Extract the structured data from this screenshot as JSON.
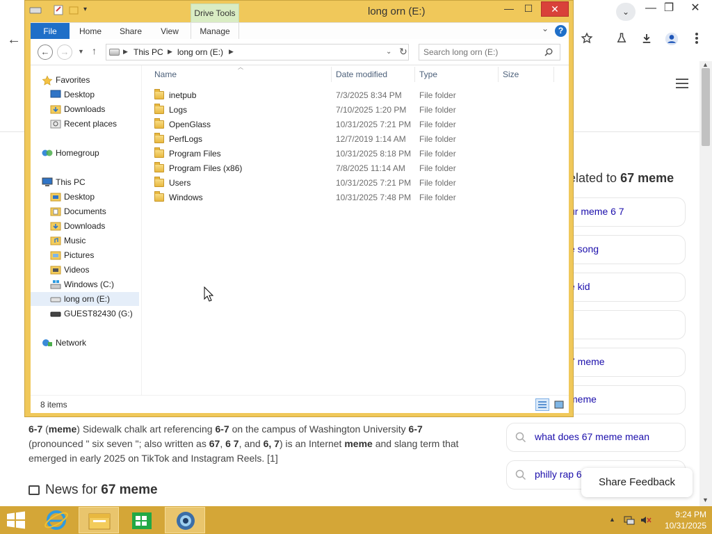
{
  "browser": {
    "tab_search_symbol": "⌄",
    "window_controls": {
      "minimize": "—",
      "maximize": "❐",
      "close": "✕"
    },
    "toolbar_icons": [
      "star-icon",
      "flask-icon",
      "download-icon",
      "profile-icon",
      "more-icon"
    ],
    "back_symbol": "←"
  },
  "page": {
    "related": {
      "title_prefix": "elated to ",
      "title_bold": "67 meme",
      "items": [
        {
          "text": "ur meme 6 7",
          "icon": "search-icon"
        },
        {
          "text": "e song",
          "icon": "search-icon"
        },
        {
          "text": "e kid",
          "icon": "search-icon"
        },
        {
          "text": "",
          "icon": "search-icon"
        },
        {
          "text": "7 meme",
          "icon": "search-icon"
        },
        {
          "text": "meme",
          "icon": "search-icon"
        },
        {
          "text": "what does 67 meme mean",
          "icon": "search-icon"
        },
        {
          "text": "philly rap 6",
          "icon": "search-icon"
        }
      ]
    },
    "snippet": {
      "t1": "6-7",
      "t2": " (",
      "t3": "meme",
      "t4": ") Sidewalk chalk art referencing ",
      "t5": "6-7",
      "t6": " on the campus of Washington University ",
      "t7": "6-7",
      "t8": " (pronounced \" six seven \"; also written as ",
      "t9": "67",
      "t10": ", ",
      "t11": "6 7",
      "t12": ", and ",
      "t13": "6, 7",
      "t14": ") is an Internet ",
      "t15": "meme",
      "t16": " and slang term that emerged in early 2025 on TikTok and Instagram Reels. [1]"
    },
    "news": {
      "prefix": "News for ",
      "bold": "67 meme"
    },
    "share_feedback": "Share Feedback"
  },
  "explorer": {
    "title": "long orn (E:)",
    "context_tab": "Drive Tools",
    "window_controls": {
      "minimize": "—",
      "maximize": "☐",
      "close": "✕"
    },
    "ribbon_tabs": {
      "file": "File",
      "home": "Home",
      "share": "Share",
      "view": "View",
      "manage": "Manage"
    },
    "help": "?",
    "address": {
      "root": "This PC",
      "current": "long orn (E:)"
    },
    "search_placeholder": "Search long orn (E:)",
    "nav_pane": {
      "favorites": "Favorites",
      "desktop_fav": "Desktop",
      "downloads_fav": "Downloads",
      "recent": "Recent places",
      "homegroup": "Homegroup",
      "this_pc": "This PC",
      "desktop": "Desktop",
      "documents": "Documents",
      "downloads": "Downloads",
      "music": "Music",
      "pictures": "Pictures",
      "videos": "Videos",
      "drive_c": "Windows (C:)",
      "drive_e": "long orn (E:)",
      "drive_g": "GUEST82430 (G:)",
      "network": "Network"
    },
    "columns": {
      "name": "Name",
      "date": "Date modified",
      "type": "Type",
      "size": "Size"
    },
    "files": [
      {
        "name": "inetpub",
        "date": "7/3/2025 8:34 PM",
        "type": "File folder",
        "size": ""
      },
      {
        "name": "Logs",
        "date": "7/10/2025 1:20 PM",
        "type": "File folder",
        "size": ""
      },
      {
        "name": "OpenGlass",
        "date": "10/31/2025 7:21 PM",
        "type": "File folder",
        "size": ""
      },
      {
        "name": "PerfLogs",
        "date": "12/7/2019 1:14 AM",
        "type": "File folder",
        "size": ""
      },
      {
        "name": "Program Files",
        "date": "10/31/2025 8:18 PM",
        "type": "File folder",
        "size": ""
      },
      {
        "name": "Program Files (x86)",
        "date": "7/8/2025 11:14 AM",
        "type": "File folder",
        "size": ""
      },
      {
        "name": "Users",
        "date": "10/31/2025 7:21 PM",
        "type": "File folder",
        "size": ""
      },
      {
        "name": "Windows",
        "date": "10/31/2025 7:48 PM",
        "type": "File folder",
        "size": ""
      }
    ],
    "status": "8 items"
  },
  "taskbar": {
    "apps": [
      "internet-explorer-icon",
      "file-explorer-icon",
      "store-icon",
      "browser-icon"
    ],
    "time": "9:24 PM",
    "date": "10/31/2025"
  }
}
